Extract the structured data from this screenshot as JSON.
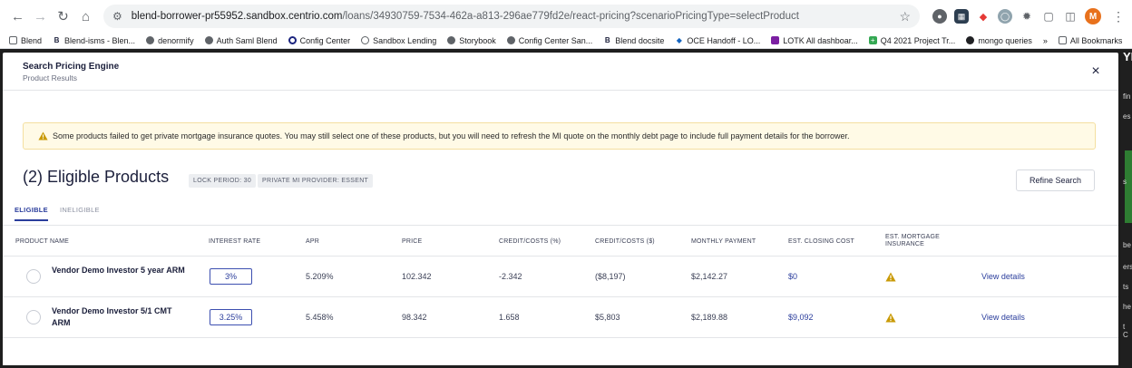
{
  "browser": {
    "url_host": "blend-borrower-pr55952.sandbox.centrio.com",
    "url_path": "/loans/34930759-7534-462a-a813-296ae779fd2e/react-pricing?scenarioPricingType=selectProduct",
    "avatar_letter": "M",
    "bookmarks": [
      "Blend",
      "Blend-isms - Blen...",
      "denormify",
      "Auth Saml Blend",
      "Config Center",
      "Sandbox Lending",
      "Storybook",
      "Config Center San...",
      "Blend docsite",
      "OCE Handoff - LO...",
      "LOTK All dashboar...",
      "Q4 2021 Project Tr...",
      "mongo queries"
    ],
    "bookmarks_overflow": "»",
    "all_bookmarks": "All Bookmarks"
  },
  "background_peek": {
    "letters": [
      "YE",
      "fin",
      "es",
      "s",
      "be",
      "ers",
      "ts",
      "he",
      "t C"
    ]
  },
  "modal": {
    "title": "Search Pricing Engine",
    "subtitle": "Product Results",
    "close_icon": "×",
    "warning_text": "Some products failed to get private mortgage insurance quotes. You may still select one of these products, but you will need to refresh the MI quote on the monthly debt page to include full payment details for the borrower.",
    "section_title": "(2) Eligible Products",
    "chips": [
      "LOCK PERIOD: 30",
      "PRIVATE MI PROVIDER: ESSENT"
    ],
    "refine_button": "Refine Search",
    "tabs": [
      {
        "label": "ELIGIBLE",
        "active": true
      },
      {
        "label": "INELIGIBLE",
        "active": false
      }
    ],
    "columns": {
      "product_name": "PRODUCT NAME",
      "interest_rate": "INTEREST RATE",
      "apr": "APR",
      "price": "PRICE",
      "credit_costs_pct": "CREDIT/COSTS (%)",
      "credit_costs_usd": "CREDIT/COSTS ($)",
      "monthly_payment": "MONTHLY PAYMENT",
      "est_closing_cost": "EST. CLOSING COST",
      "est_mortgage_insurance": "EST. MORTGAGE INSURANCE"
    },
    "rows": [
      {
        "product_name": "Vendor Demo Investor 5 year ARM",
        "interest_rate": "3%",
        "apr": "5.209%",
        "price": "102.342",
        "credit_costs_pct": "-2.342",
        "credit_costs_usd": "($8,197)",
        "monthly_payment": "$2,142.27",
        "est_closing_cost": "$0",
        "mi_icon": "warning-icon",
        "link": "View details"
      },
      {
        "product_name": "Vendor Demo Investor 5/1 CMT ARM",
        "interest_rate": "3.25%",
        "apr": "5.458%",
        "price": "98.342",
        "credit_costs_pct": "1.658",
        "credit_costs_usd": "$5,803",
        "monthly_payment": "$2,189.88",
        "est_closing_cost": "$9,092",
        "mi_icon": "warning-icon",
        "link": "View details"
      }
    ]
  },
  "colors": {
    "accent": "#2a3d9c",
    "warning_bg": "#fffae6",
    "warning_icon": "#c99a06",
    "text_dark": "#1b1f3b"
  }
}
